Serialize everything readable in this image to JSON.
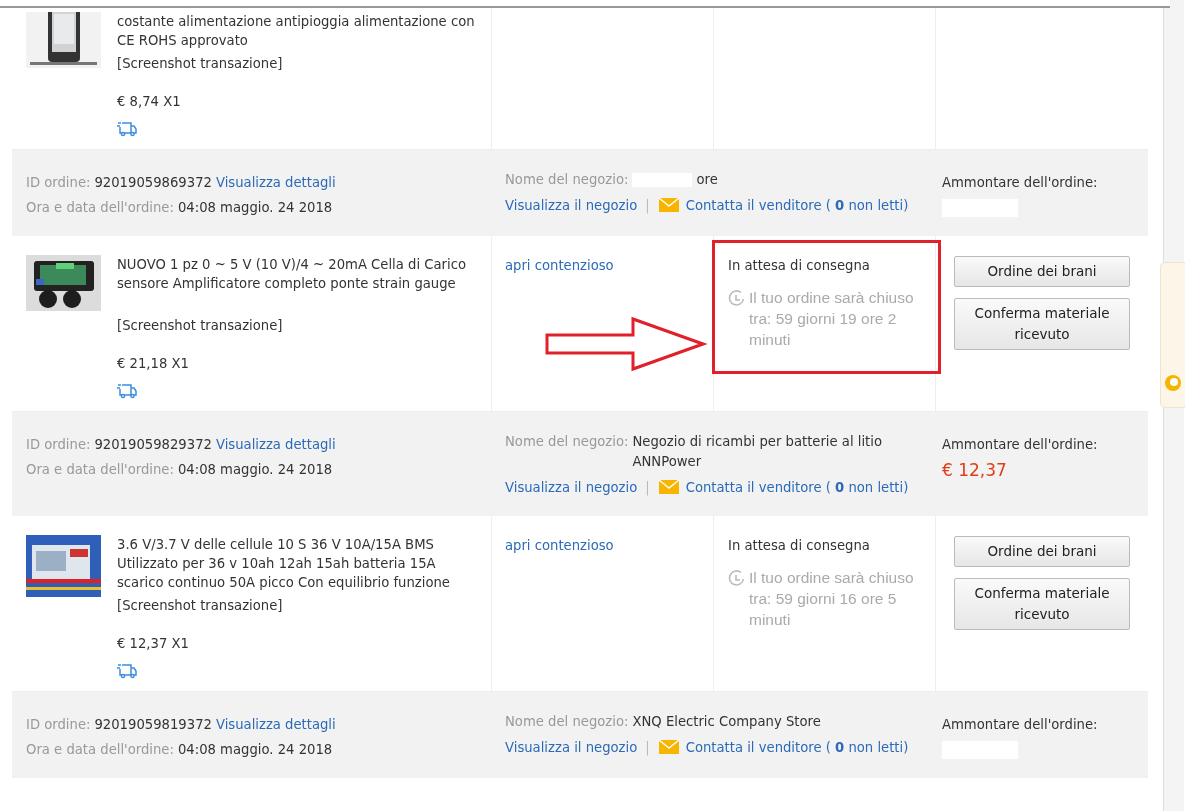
{
  "rows": [
    {
      "kind": "item",
      "title": "costante alimentazione antipioggia alimentazione con CE ROHS approvato",
      "snapshot_link": "[Screenshot transazione]",
      "price": "€ 8,74 X1",
      "highlighted": false
    },
    {
      "kind": "header",
      "id_label": "ID ordine:",
      "id": "92019059869372",
      "details_link": "Visualizza dettagli",
      "date_label": "Ora e data dell'ordine:",
      "date": "04:08 maggio. 24 2018",
      "shop_label": "Nome del negozio:",
      "shop": "ore",
      "shop_redacted": true,
      "view_shop_link": "Visualizza il negozio",
      "separator": "|",
      "contact_link": "Contatta il venditore ( **0** non letti)",
      "amount_label": "Ammontare dell'ordine:",
      "amount_redacted": true
    },
    {
      "kind": "item",
      "title": "NUOVO 1 pz 0 ~ 5 V (10 V)/4 ~ 20mA Cella di Carico sensore Amplificatore completo ponte strain gauge",
      "snapshot_link": "[Screenshot transazione]",
      "price": "€ 21,18 X1",
      "dispute_link": "apri contenzioso",
      "status": "In attesa di consegna",
      "countdown": "Il tuo ordine sarà chiuso tra: 59 giorni 19 ore 2 minuti",
      "buttons": [
        "Ordine dei brani",
        "Conferma materiale ricevuto"
      ],
      "highlighted": true
    },
    {
      "kind": "header",
      "id_label": "ID ordine:",
      "id": "92019059829372",
      "details_link": "Visualizza dettagli",
      "date_label": "Ora e data dell'ordine:",
      "date": "04:08 maggio. 24 2018",
      "shop_label": "Nome del negozio:",
      "shop": "Negozio di ricambi per batterie al litio ANNPower",
      "shop_redacted": false,
      "view_shop_link": "Visualizza il negozio",
      "separator": "|",
      "contact_link": "Contatta il venditore ( **0** non letti)",
      "amount_label": "Ammontare dell'ordine:",
      "amount": "€ 12,37",
      "amount_redacted": false
    },
    {
      "kind": "item",
      "title": "3.6 V/3.7 V delle cellule 10 S 36 V 10A/15A BMS Utilizzato per 36 v 10ah 12ah 15ah batteria 15A scarico continuo 50A picco Con equilibrio funzione",
      "snapshot_link": "[Screenshot transazione]",
      "price": "€ 12,37 X1",
      "dispute_link": "apri contenzioso",
      "status": "In attesa di consegna",
      "countdown": "Il tuo ordine sarà chiuso tra: 59 giorni 16 ore 5 minuti",
      "buttons": [
        "Ordine dei brani",
        "Conferma materiale ricevuto"
      ],
      "highlighted": false
    },
    {
      "kind": "header",
      "id_label": "ID ordine:",
      "id": "92019059819372",
      "details_link": "Visualizza dettagli",
      "date_label": "Ora e data dell'ordine:",
      "date": "04:08 maggio. 24 2018",
      "shop_label": "Nome del negozio:",
      "shop": "XNQ Electric Company Store",
      "shop_redacted": false,
      "view_shop_link": "Visualizza il negozio",
      "separator": "|",
      "contact_link": "Contatta il venditore ( **0** non letti)",
      "amount_label": "Ammontare dell'ordine:",
      "amount_redacted": true
    }
  ]
}
